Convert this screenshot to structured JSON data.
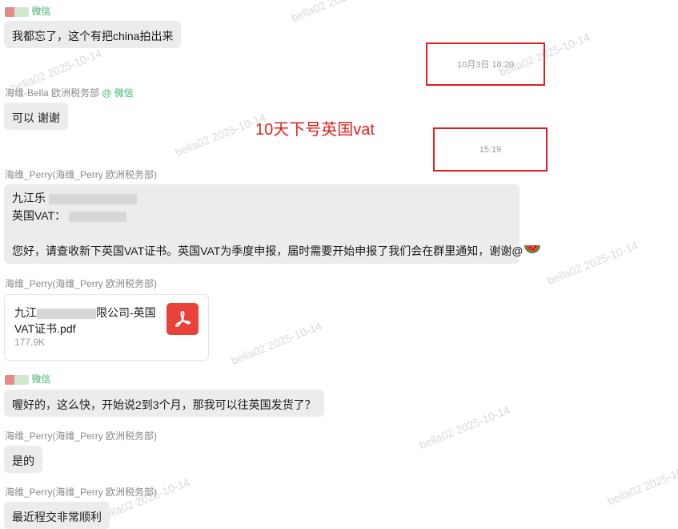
{
  "messages": {
    "m1": {
      "sender_suffix": "微信",
      "text": "我都忘了，这个有把china拍出来"
    },
    "time1": "10月3日 18:20",
    "m2": {
      "sender": "海维-Bella 欧洲税务部",
      "sender_suffix": "@ 微信",
      "text": "可以 谢谢"
    },
    "annotation": "10天下号英国vat",
    "time2": "15:19",
    "m3": {
      "sender": "海维_Perry(海维_Perry 欧洲税务部)",
      "line1_prefix": "九江乐",
      "line2_prefix": "英国VAT：",
      "line3": "您好，请查收新下英国VAT证书。英国VAT为季度申报，届时需要开始申报了我们会在群里通知，谢谢@"
    },
    "m4": {
      "sender": "海维_Perry(海维_Perry 欧洲税务部)",
      "file_name_prefix": "九江",
      "file_name_mid": "限公司-英国",
      "file_name_line2": "VAT证书.pdf",
      "file_size": "177.9K"
    },
    "m5": {
      "sender_suffix": "微信",
      "text": "喔好的，这么快，开始说2到3个月，那我可以往英国发货了？"
    },
    "m6": {
      "sender": "海维_Perry(海维_Perry 欧洲税务部)",
      "text": "是的"
    },
    "m7": {
      "sender": "海维_Perry(海维_Perry 欧洲税务部)",
      "text": "最近程交非常顺利"
    }
  },
  "watermark": "bella02 2025-10-14",
  "colors": {
    "annotation": "#e02020",
    "wechat": "#3cb371",
    "bubble": "#ececec",
    "pdf": "#e8423a"
  },
  "icons": {
    "file": "pdf-icon",
    "emoji": "watermelon-emoji"
  }
}
